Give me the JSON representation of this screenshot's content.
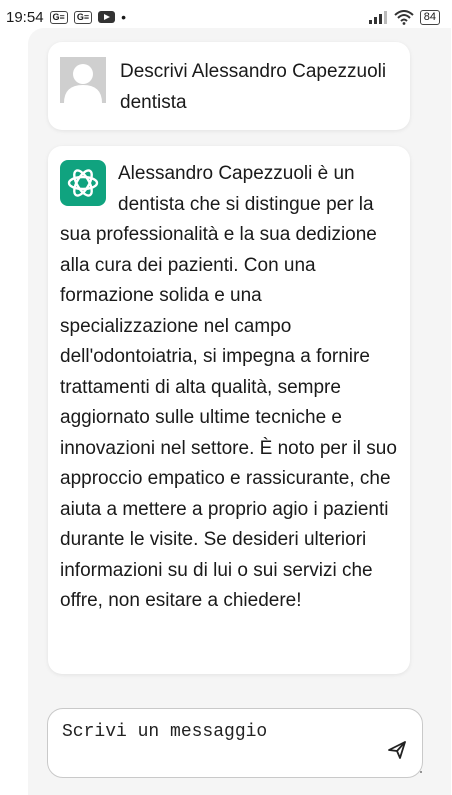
{
  "status_bar": {
    "time": "19:54",
    "badge1": "G≡",
    "badge2": "G≡",
    "dot": "•",
    "battery": "84"
  },
  "chat": {
    "user_message": "Descrivi Alessandro Capezzuoli dentista",
    "assistant_message": "Alessandro Capezzuoli è un dentista che si distingue per la sua professionalità e la sua dedizione alla cura dei pazienti. Con una formazione solida e una specializzazione nel campo dell'odontoiatria, si impegna a fornire trattamenti di alta qualità, sempre aggiornato sulle ultime tecniche e innovazioni nel settore. È noto per il suo approccio empatico e rassicurante, che aiuta a mettere a proprio agio i pazienti durante le visite. Se desideri ulteriori informazioni su di lui o sui servizi che offre, non esitare a chiedere!"
  },
  "composer": {
    "placeholder": "Scrivi un messaggio",
    "value": ""
  },
  "icons": {
    "user_avatar": "person-silhouette",
    "assistant_avatar": "openai-logo",
    "send": "send-icon",
    "signal": "signal-icon",
    "wifi": "wifi-icon",
    "youtube": "youtube-icon"
  },
  "colors": {
    "assistant_avatar_bg": "#10a37f",
    "user_avatar_bg": "#cfcfcf",
    "frame_bg": "#f5f5f5"
  }
}
